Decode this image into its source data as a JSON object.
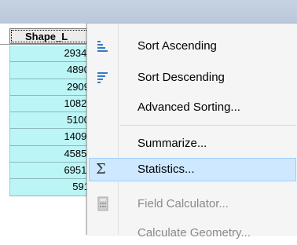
{
  "table": {
    "column_header": "Shape_L",
    "rows": [
      "2934.",
      "4890",
      "2909",
      "1082.",
      "5100",
      "1409.",
      "4585.",
      "6951.",
      "591"
    ]
  },
  "context_menu": {
    "items": [
      {
        "label": "Sort Ascending",
        "icon": "sort-ascending-icon",
        "enabled": true
      },
      {
        "label": "Sort Descending",
        "icon": "sort-descending-icon",
        "enabled": true
      },
      {
        "label": "Advanced Sorting...",
        "icon": "",
        "enabled": true
      },
      {
        "label": "Summarize...",
        "icon": "",
        "enabled": true
      },
      {
        "label": "Statistics...",
        "icon": "sigma-icon",
        "enabled": true,
        "highlighted": true
      },
      {
        "label": "Field Calculator...",
        "icon": "calculator-icon",
        "enabled": false
      },
      {
        "label": "Calculate Geometry...",
        "icon": "",
        "enabled": false
      }
    ]
  },
  "colors": {
    "cell_background": "#bcf5f5",
    "highlight": "#cde8ff",
    "highlight_border": "#99d1ff",
    "disabled_text": "#8a8a8a"
  }
}
